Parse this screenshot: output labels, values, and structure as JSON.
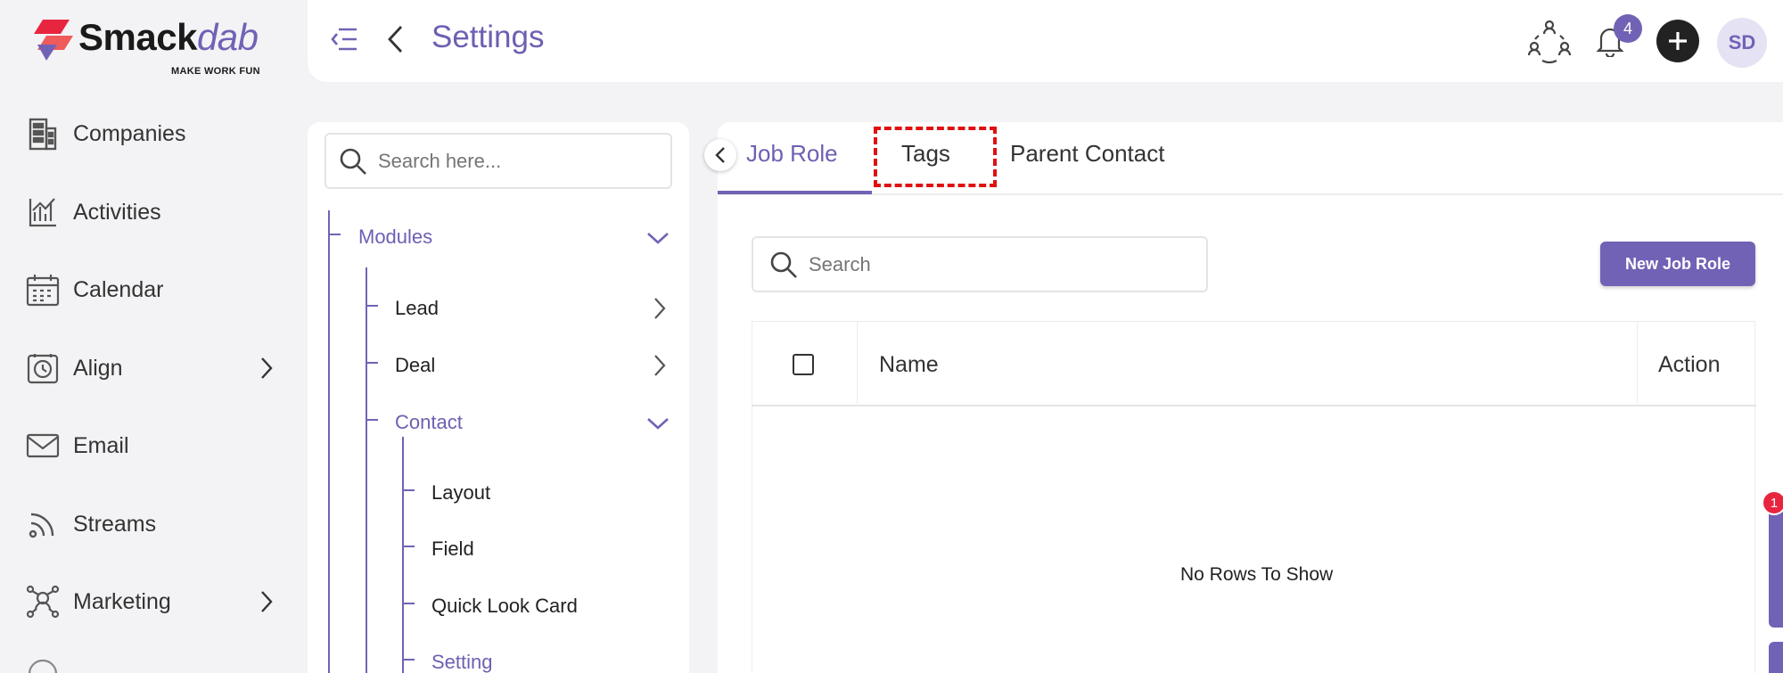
{
  "app": {
    "logo_name": "Smackdab",
    "logo_prefix": "Smack",
    "logo_suffix": "dab",
    "tagline": "MAKE WORK FUN"
  },
  "sidebar": {
    "items": [
      {
        "label": "Companies",
        "icon": "building-icon",
        "has_chevron": false
      },
      {
        "label": "Activities",
        "icon": "activity-chart-icon",
        "has_chevron": false
      },
      {
        "label": "Calendar",
        "icon": "calendar-icon",
        "has_chevron": false
      },
      {
        "label": "Align",
        "icon": "align-clock-icon",
        "has_chevron": true
      },
      {
        "label": "Email",
        "icon": "envelope-icon",
        "has_chevron": false
      },
      {
        "label": "Streams",
        "icon": "rss-icon",
        "has_chevron": false
      },
      {
        "label": "Marketing",
        "icon": "network-icon",
        "has_chevron": true
      }
    ]
  },
  "header": {
    "title": "Settings",
    "notification_count": "4",
    "avatar_initials": "SD"
  },
  "tree": {
    "search_placeholder": "Search here...",
    "modules": "Modules",
    "lead": "Lead",
    "deal": "Deal",
    "contact": "Contact",
    "layout": "Layout",
    "field": "Field",
    "quick_look": "Quick Look Card",
    "setting": "Setting"
  },
  "tabs": {
    "job_role": "Job Role",
    "tags": "Tags",
    "parent_contact": "Parent Contact"
  },
  "main": {
    "search_placeholder": "Search",
    "new_button": "New Job Role",
    "columns": {
      "name": "Name",
      "action": "Action"
    },
    "empty_text": "No Rows To Show"
  },
  "side_badge": "1",
  "colors": {
    "accent": "#7262b5",
    "highlight": "#e01010",
    "badge_red": "#e8253f"
  }
}
